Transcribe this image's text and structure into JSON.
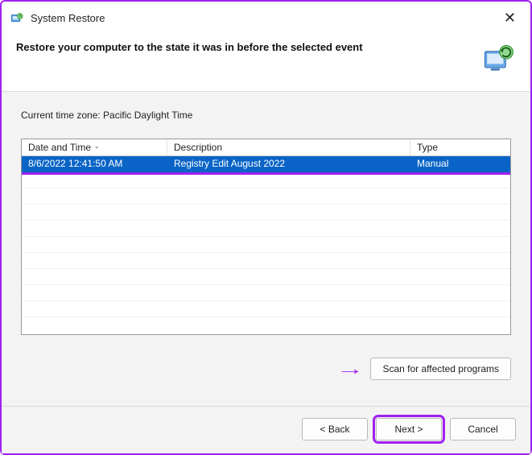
{
  "window": {
    "title": "System Restore"
  },
  "header": {
    "heading": "Restore your computer to the state it was in before the selected event"
  },
  "content": {
    "timezone_label": "Current time zone: Pacific Daylight Time",
    "columns": {
      "date": "Date and Time",
      "desc": "Description",
      "type": "Type"
    },
    "rows": [
      {
        "date": "8/6/2022 12:41:50 AM",
        "desc": "Registry Edit August 2022",
        "type": "Manual"
      }
    ],
    "scan_button": "Scan for affected programs"
  },
  "footer": {
    "back": "< Back",
    "next": "Next >",
    "cancel": "Cancel"
  }
}
